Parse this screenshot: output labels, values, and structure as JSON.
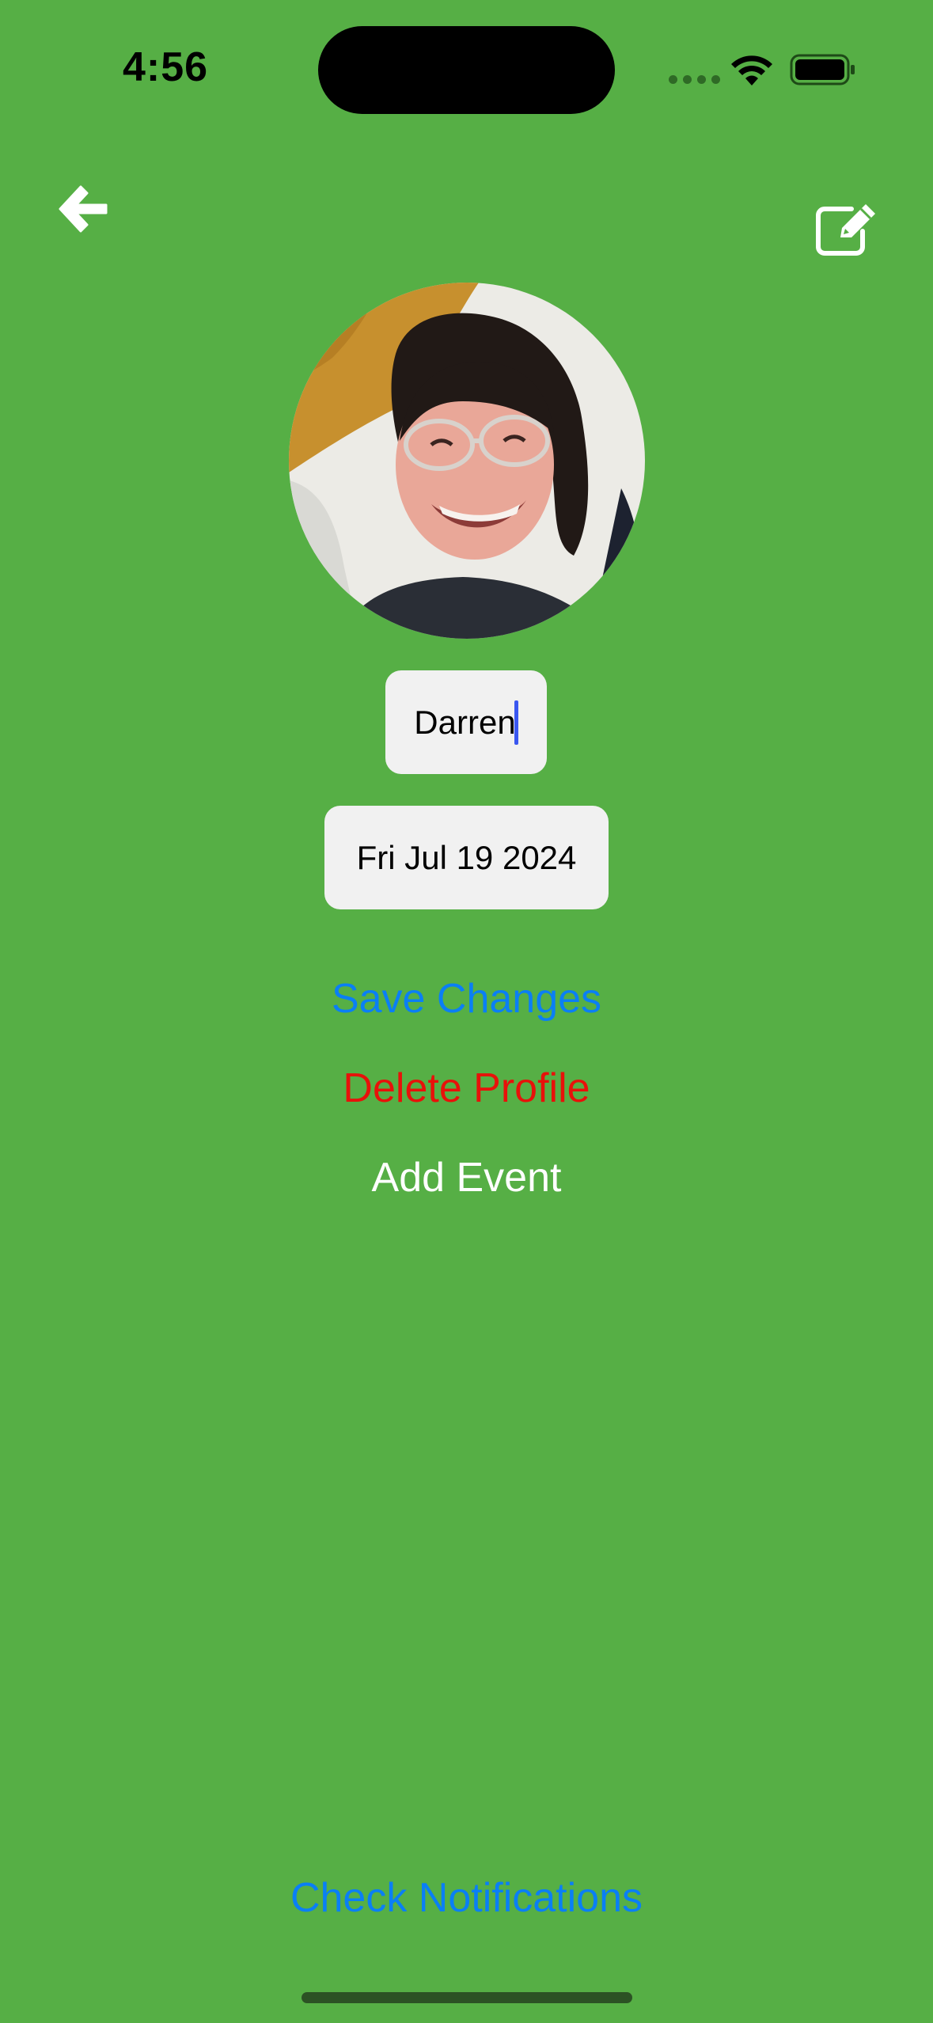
{
  "status_bar": {
    "time": "4:56"
  },
  "nav": {
    "back_icon": "arrow-left-icon",
    "edit_icon": "edit-square-icon"
  },
  "profile": {
    "name_value": "Darren",
    "date_value": "Fri Jul 19 2024"
  },
  "actions": {
    "save_label": "Save Changes",
    "delete_label": "Delete Profile",
    "add_event_label": "Add Event",
    "notifications_label": "Check Notifications"
  },
  "colors": {
    "background": "#56af45",
    "link_blue": "#0a7ff5",
    "danger_red": "#e8110a",
    "field_bg": "#f1f1f1"
  }
}
